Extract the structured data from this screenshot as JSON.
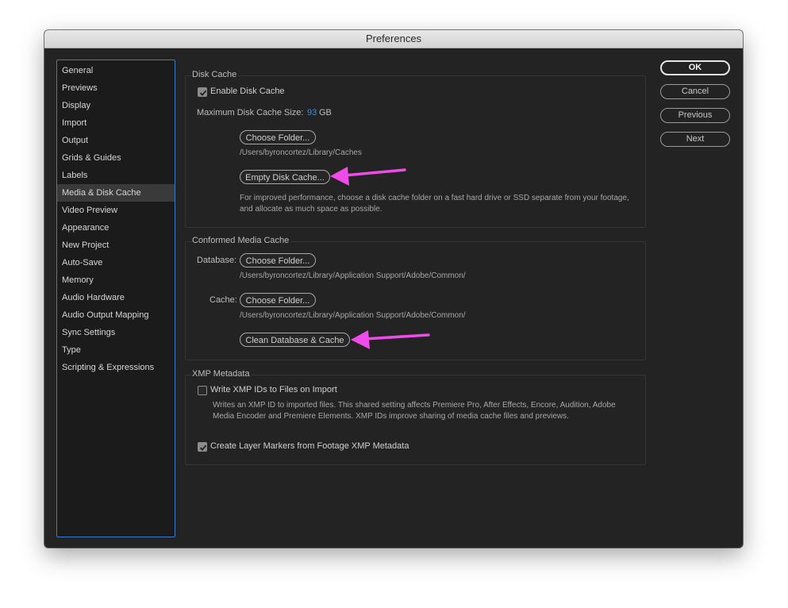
{
  "window": {
    "title": "Preferences"
  },
  "sidebar": {
    "items": [
      {
        "label": "General"
      },
      {
        "label": "Previews"
      },
      {
        "label": "Display"
      },
      {
        "label": "Import"
      },
      {
        "label": "Output"
      },
      {
        "label": "Grids & Guides"
      },
      {
        "label": "Labels"
      },
      {
        "label": "Media & Disk Cache",
        "selected": true
      },
      {
        "label": "Video Preview"
      },
      {
        "label": "Appearance"
      },
      {
        "label": "New Project"
      },
      {
        "label": "Auto-Save"
      },
      {
        "label": "Memory"
      },
      {
        "label": "Audio Hardware"
      },
      {
        "label": "Audio Output Mapping"
      },
      {
        "label": "Sync Settings"
      },
      {
        "label": "Type"
      },
      {
        "label": "Scripting & Expressions"
      }
    ]
  },
  "buttons": {
    "ok": "OK",
    "cancel": "Cancel",
    "previous": "Previous",
    "next": "Next"
  },
  "disk_cache": {
    "title": "Disk Cache",
    "enable_label": "Enable Disk Cache",
    "enable_checked": true,
    "max_size_label": "Maximum Disk Cache Size:",
    "max_size_value": "93",
    "max_size_unit": "GB",
    "choose_folder": "Choose Folder...",
    "folder_path": "/Users/byroncortez/Library/Caches",
    "empty_button": "Empty Disk Cache...",
    "help_line1": "For improved performance, choose a disk cache folder on a fast hard drive or SSD separate from your footage,",
    "help_line2": "and allocate as much space as possible."
  },
  "conformed": {
    "title": "Conformed Media Cache",
    "database_label": "Database:",
    "database_button": "Choose Folder...",
    "database_path": "/Users/byroncortez/Library/Application Support/Adobe/Common/",
    "cache_label": "Cache:",
    "cache_button": "Choose Folder...",
    "cache_path": "/Users/byroncortez/Library/Application Support/Adobe/Common/",
    "clean_button": "Clean Database & Cache"
  },
  "xmp": {
    "title": "XMP Metadata",
    "write_label": "Write XMP IDs to Files on Import",
    "write_checked": false,
    "desc_line1": "Writes an XMP ID to imported files. This shared setting affects Premiere Pro, After Effects, Encore, Audition, Adobe",
    "desc_line2": "Media Encoder and Premiere Elements. XMP IDs improve sharing of media cache files and previews.",
    "markers_label": "Create Layer Markers from Footage XMP Metadata",
    "markers_checked": true
  },
  "colors": {
    "accent": "#3d8fe0",
    "annotation_arrow": "#ee4be8",
    "sidebar_focus": "#3f78c7"
  }
}
